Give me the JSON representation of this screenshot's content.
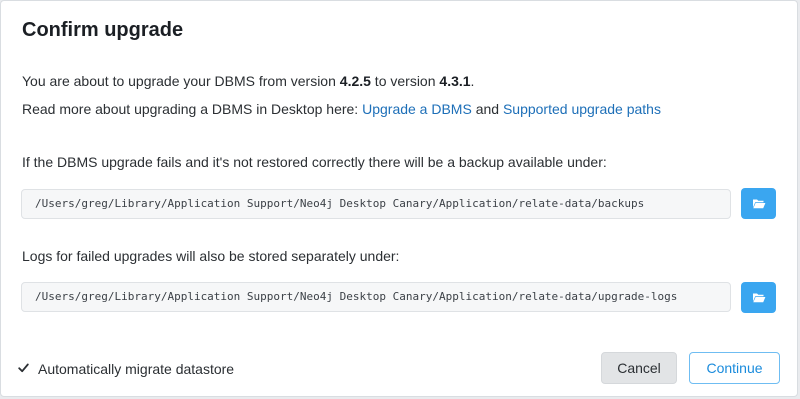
{
  "dialog": {
    "title": "Confirm upgrade",
    "intro": {
      "prefix": "You are about to upgrade your DBMS from version ",
      "from_version": "4.2.5",
      "middle": " to version ",
      "to_version": "4.3.1",
      "suffix": "."
    },
    "read_more": {
      "prefix": "Read more about upgrading a DBMS in Desktop here: ",
      "link1": "Upgrade a DBMS",
      "connector": " and ",
      "link2": "Supported upgrade paths"
    },
    "backup": {
      "label": "If the DBMS upgrade fails and it's not restored correctly there will be a backup available under:",
      "path": "/Users/greg/Library/Application Support/Neo4j Desktop Canary/Application/relate-data/backups",
      "button_icon": "folder-open-icon"
    },
    "logs": {
      "label": "Logs for failed upgrades will also be stored separately under:",
      "path": "/Users/greg/Library/Application Support/Neo4j Desktop Canary/Application/relate-data/upgrade-logs",
      "button_icon": "folder-open-icon"
    },
    "footer": {
      "checkbox_label": "Automatically migrate datastore",
      "checkbox_checked": true,
      "cancel_label": "Cancel",
      "continue_label": "Continue"
    }
  },
  "colors": {
    "link": "#1d6fb8",
    "folder_button": "#3aa6f0",
    "continue_border": "#6fbdf2",
    "continue_text": "#1a8bdc"
  }
}
